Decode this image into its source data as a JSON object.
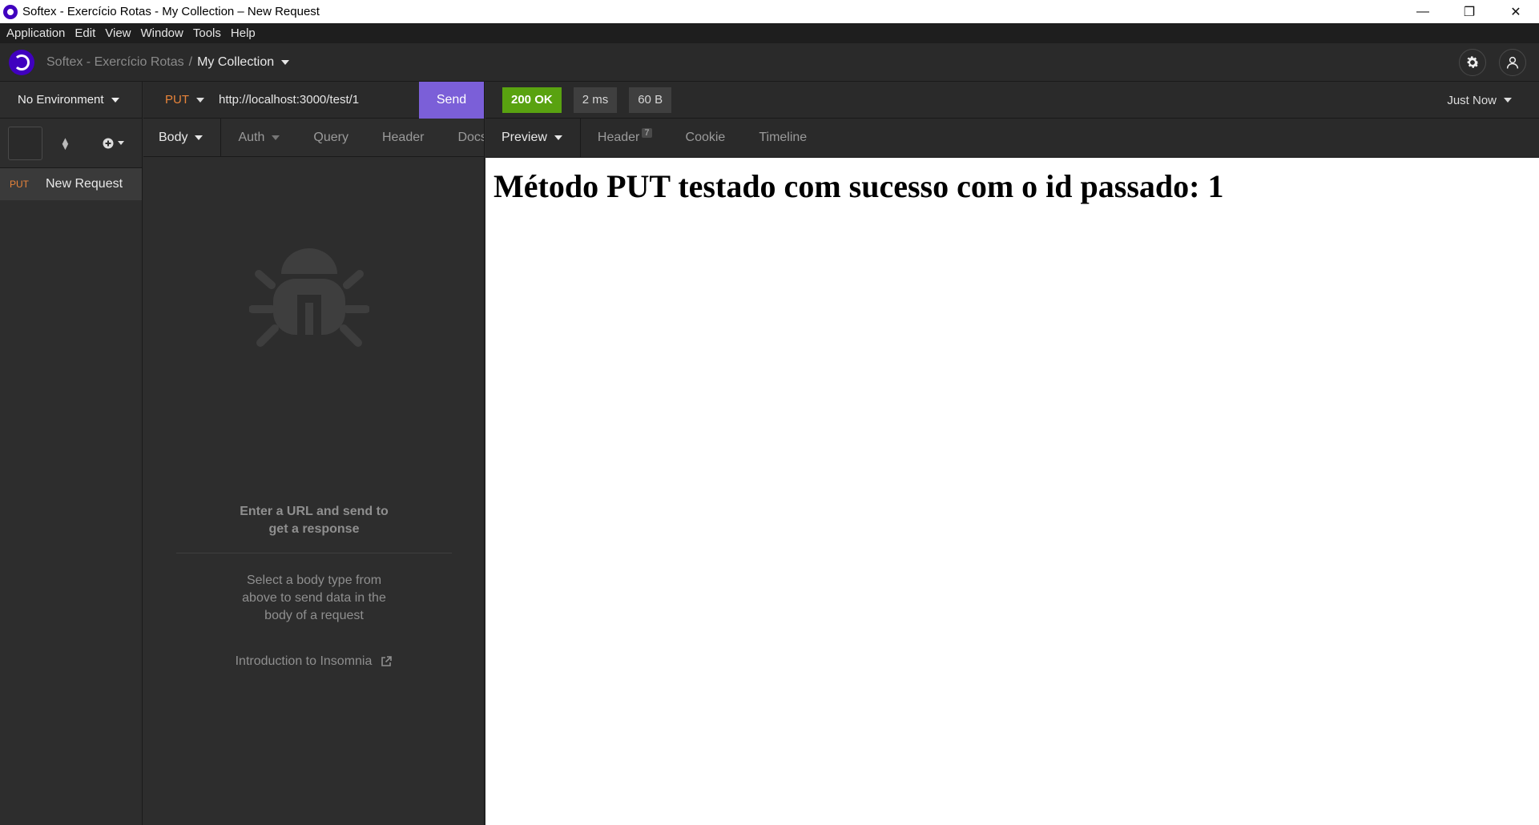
{
  "window": {
    "title": "Softex - Exercício Rotas - My Collection – New Request",
    "controls": {
      "minimize": "—",
      "restore": "❐",
      "close": "✕"
    }
  },
  "menu": [
    "Application",
    "Edit",
    "View",
    "Window",
    "Tools",
    "Help"
  ],
  "header": {
    "workspace": "Softex - Exercício Rotas",
    "separator": "/",
    "collection": "My Collection"
  },
  "sidebar": {
    "environment": "No Environment",
    "filter_value": "",
    "requests": [
      {
        "method": "PUT",
        "name": "New Request"
      }
    ]
  },
  "request": {
    "method": "PUT",
    "url": "http://localhost:3000/test/1",
    "send_label": "Send",
    "tabs": [
      "Body",
      "Auth",
      "Query",
      "Header",
      "Docs"
    ],
    "empty_title": "Enter a URL and send to get a response",
    "empty_sub": "Select a body type from above to send data in the body of a request",
    "intro_link": "Introduction to Insomnia"
  },
  "response": {
    "status": "200 OK",
    "time": "2 ms",
    "size": "60 B",
    "history": "Just Now",
    "tabs": {
      "preview": "Preview",
      "header": "Header",
      "header_count": "7",
      "cookie": "Cookie",
      "timeline": "Timeline"
    },
    "body_heading": "Método PUT testado com sucesso com o id passado: 1"
  },
  "colors": {
    "brand": "#4000bf",
    "send": "#7b5fd8",
    "status_ok": "#59a210",
    "method_put": "#e8843a"
  },
  "icons": [
    "app-logo-icon",
    "gear-icon",
    "user-icon",
    "bug-icon",
    "sort-icon",
    "add-circle-icon",
    "external-link-icon"
  ]
}
